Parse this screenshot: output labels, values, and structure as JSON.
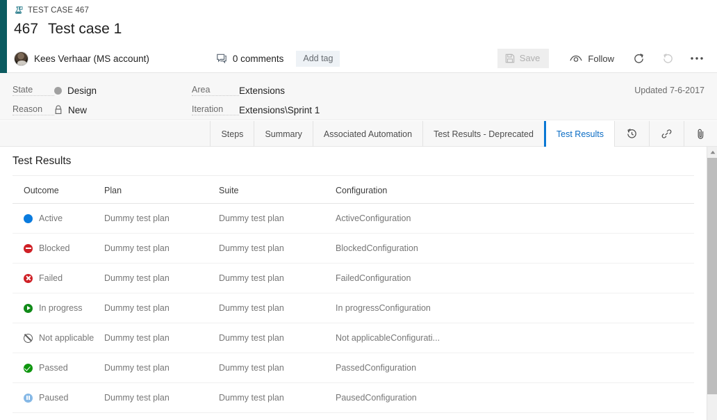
{
  "theme": {
    "accent_rail": "#0c5b60",
    "active_tab": "#0a78d4",
    "chrome_bg": "#f7f7f7"
  },
  "header": {
    "breadcrumb": "TEST CASE 467",
    "breadcrumb_icon": "test-case-icon",
    "work_item_id": "467",
    "work_item_title": "Test case 1",
    "author": "Kees Verhaar (MS account)",
    "comments_label": "0 comments",
    "comments_icon": "comment-icon",
    "add_tag_label": "Add tag",
    "save_label": "Save",
    "save_icon": "save-disk-icon",
    "follow_label": "Follow",
    "follow_icon": "eye-icon",
    "refresh_icon": "refresh-icon",
    "revert_icon": "undo-icon",
    "more_icon": "ellipsis-icon"
  },
  "fields": {
    "state_label": "State",
    "state_value": "Design",
    "state_color": "#a0a0a0",
    "reason_label": "Reason",
    "reason_value": "New",
    "reason_icon": "lock-icon",
    "area_label": "Area",
    "area_value": "Extensions",
    "iteration_label": "Iteration",
    "iteration_value": "Extensions\\Sprint 1",
    "updated": "Updated 7-6-2017"
  },
  "tabs": [
    {
      "label": "Steps",
      "active": false,
      "type": "text"
    },
    {
      "label": "Summary",
      "active": false,
      "type": "text"
    },
    {
      "label": "Associated Automation",
      "active": false,
      "type": "text"
    },
    {
      "label": "Test Results - Deprecated",
      "active": false,
      "type": "text"
    },
    {
      "label": "Test Results",
      "active": true,
      "type": "text"
    },
    {
      "label": "",
      "active": false,
      "type": "icon",
      "icon": "history-icon"
    },
    {
      "label": "",
      "active": false,
      "type": "icon",
      "icon": "link-icon"
    },
    {
      "label": "",
      "active": false,
      "type": "icon",
      "icon": "attachment-icon"
    }
  ],
  "main": {
    "section_title": "Test Results",
    "columns": [
      "Outcome",
      "Plan",
      "Suite",
      "Configuration"
    ],
    "rows": [
      {
        "outcome": "Active",
        "status": "active",
        "plan": "Dummy test plan",
        "suite": "Dummy test plan",
        "configuration": "ActiveConfiguration"
      },
      {
        "outcome": "Blocked",
        "status": "blocked",
        "plan": "Dummy test plan",
        "suite": "Dummy test plan",
        "configuration": "BlockedConfiguration"
      },
      {
        "outcome": "Failed",
        "status": "failed",
        "plan": "Dummy test plan",
        "suite": "Dummy test plan",
        "configuration": "FailedConfiguration"
      },
      {
        "outcome": "In progress",
        "status": "inprogress",
        "plan": "Dummy test plan",
        "suite": "Dummy test plan",
        "configuration": "In progressConfiguration"
      },
      {
        "outcome": "Not applicable",
        "status": "na",
        "plan": "Dummy test plan",
        "suite": "Dummy test plan",
        "configuration": "Not applicableConfigurati..."
      },
      {
        "outcome": "Passed",
        "status": "passed",
        "plan": "Dummy test plan",
        "suite": "Dummy test plan",
        "configuration": "PassedConfiguration"
      },
      {
        "outcome": "Paused",
        "status": "paused",
        "plan": "Dummy test plan",
        "suite": "Dummy test plan",
        "configuration": "PausedConfiguration"
      }
    ]
  },
  "scrollbar": {
    "up_icon": "caret-up-icon"
  }
}
